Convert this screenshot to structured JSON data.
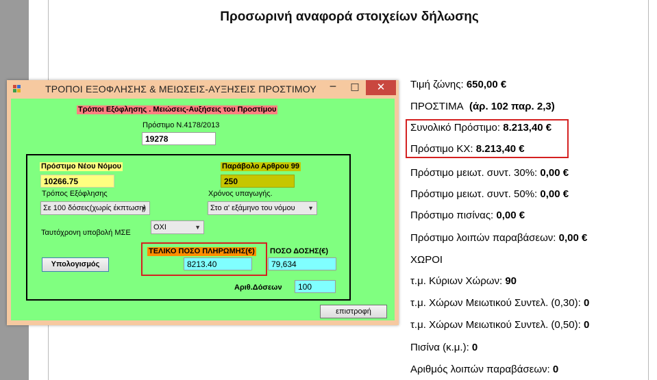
{
  "report": {
    "title": "Προσωρινή αναφορά στοιχείων δήλωσης",
    "lines": [
      {
        "label": "Τιμή ζώνης:",
        "value": "650,00 €"
      },
      {
        "label": "ΠΡΟΣΤΙΜΑ",
        "value": "(άρ. 102 παρ. 2,3)"
      },
      {
        "label": "Συνολικό Πρόστιμο:",
        "value": "8.213,40 €"
      },
      {
        "label": "Πρόστιμο ΚΧ:",
        "value": "8.213,40 €"
      },
      {
        "label": "Πρόστιμο μειωτ. συντ. 30%:",
        "value": "0,00 €"
      },
      {
        "label": "Πρόστιμο μειωτ. συντ. 50%:",
        "value": "0,00 €"
      },
      {
        "label": "Πρόστιμο πισίνας:",
        "value": "0,00 €"
      },
      {
        "label": "Πρόστιμο λοιπών παραβάσεων:",
        "value": "0,00 €"
      },
      {
        "label": "ΧΩΡΟΙ",
        "value": ""
      },
      {
        "label": "τ.μ. Κύριων Χώρων:",
        "value": "90"
      },
      {
        "label": "τ.μ. Χώρων Μειωτικού Συντελ. (0,30):",
        "value": "0"
      },
      {
        "label": "τ.μ. Χώρων Μειωτικού Συντελ. (0,50):",
        "value": "0"
      },
      {
        "label": "Πισίνα (κ.μ.):",
        "value": "0"
      },
      {
        "label": "Αριθμός λοιπών παραβάσεων:",
        "value": "0"
      }
    ]
  },
  "dialog": {
    "title": "ΤΡΟΠΟΙ ΕΞΟΦΛΗΣΗΣ & ΜΕΙΩΣΕΙΣ-ΑΥΞΗΣΕΙΣ ΠΡΟΣΤΙΜΟΥ",
    "controls": {
      "minimize": "─",
      "maximize": "□",
      "close": "✕"
    },
    "header": "Τρόποι Εξόφλησης . Μειώσεις-Αυξήσεις του Προστίμου",
    "law_label": "Πρόστιμο Ν.4178/2013",
    "law_value": "19278",
    "new_law_label": "Πρόστιμο Νέου Νόμου",
    "new_law_value": "10266.75",
    "fee_label": "Παράβολο Αρθρου 99",
    "fee_value": "250",
    "payment_method_label": "Τρόπος Εξόφλησης",
    "payment_method_value": "Σε 100 δόσεις(χωρίς έκπτωση)",
    "time_label": "Χρόνος υπαγωγής.",
    "time_value": "Στο α' εξάμηνο του νόμου",
    "mse_label": "Ταυτόχρονη υποβολή ΜΣΕ",
    "mse_value": "ΟΧΙ",
    "calc_button": "Υπολογισμός",
    "final_label": "ΤΕΛΙΚΟ ΠΟΣΟ ΠΛΗΡΩΜΗΣ(€)",
    "final_value": "8213.40",
    "installment_label": "ΠΟΣΟ ΔΟΣΗΣ(€)",
    "installment_value": "79,634",
    "installments_count_label": "Αριθ.Δόσεων",
    "installments_count_value": "100",
    "return_button": "επιστροφή"
  },
  "colors": {
    "dialog_background": "#80ff80",
    "window_frame": "#f6c9a0",
    "header_highlight": "#ff8080",
    "yellow_field": "#ffff80",
    "fee_highlight": "#c6c600",
    "final_highlight": "#ff8c00",
    "cyan_field": "#80ffff",
    "annotation_red": "#d42020"
  }
}
